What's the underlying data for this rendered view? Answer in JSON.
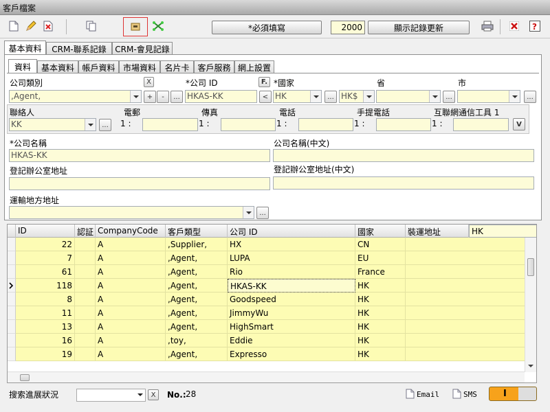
{
  "window": {
    "title": "客戶檔案"
  },
  "toolbar": {
    "required_label": "*必須填寫",
    "record_count": "2000",
    "refresh_label": "顯示記錄更新"
  },
  "main_tabs": [
    {
      "label": "基本資料",
      "active": true
    },
    {
      "label": "CRM-聯系記錄",
      "active": false
    },
    {
      "label": "CRM-會見記錄",
      "active": false
    }
  ],
  "sub_tabs": [
    {
      "label": "資料",
      "active": true
    },
    {
      "label": "基本資料",
      "active": false
    },
    {
      "label": "帳戶資料",
      "active": false
    },
    {
      "label": "市場資料",
      "active": false
    },
    {
      "label": "名片卡",
      "active": false
    },
    {
      "label": "客戶服務",
      "active": false
    },
    {
      "label": "網上設置",
      "active": false
    }
  ],
  "form": {
    "company_type_label": "公司類別",
    "company_type_value": ",Agent,",
    "company_id_label": "*公司 ID",
    "company_id_value": "HKAS-KK",
    "f_button": "F.",
    "country_label": "*國家",
    "country_value": "HK",
    "currency_value": "HK$",
    "province_label": "省",
    "city_label": "市",
    "contact_label": "聯絡人",
    "contact_value": "KK",
    "email_label": "電郵",
    "fax_label": "傳真",
    "phone_label": "電話",
    "mobile_label": "手提電話",
    "im_label": "互聯網通信工具 1",
    "index_prefix": "1 :",
    "company_name_label": "*公司名稱",
    "company_name_value": "HKAS-KK",
    "company_name_cn_label": "公司名稱(中文)",
    "office_addr_label": "登記辦公室地址",
    "office_addr_cn_label": "登記辦公室地址(中文)",
    "shipping_addr_label": "運輸地方地址",
    "x_btn": "X",
    "plus_btn": "+",
    "minus_btn": "-",
    "ellipsis": "...",
    "lt_btn": "<",
    "v_btn": "V"
  },
  "grid": {
    "headers": [
      "ID",
      "認証",
      "CompanyCode",
      "客戶類型",
      "公司 ID",
      "國家",
      "裝運地址"
    ],
    "filter_value": "HK",
    "rows": [
      {
        "id": "22",
        "cert": "",
        "code": "A",
        "type": ",Supplier,",
        "company": "HX",
        "country": "CN",
        "ship": ""
      },
      {
        "id": "7",
        "cert": "",
        "code": "A",
        "type": ",Agent,",
        "company": "LUPA",
        "country": "EU",
        "ship": ""
      },
      {
        "id": "61",
        "cert": "",
        "code": "A",
        "type": ",Agent,",
        "company": "Rio",
        "country": "France",
        "ship": ""
      },
      {
        "id": "118",
        "cert": "",
        "code": "A",
        "type": ",Agent,",
        "company": "HKAS-KK",
        "country": "HK",
        "ship": "",
        "current": true
      },
      {
        "id": "8",
        "cert": "",
        "code": "A",
        "type": ",Agent,",
        "company": "Goodspeed",
        "country": "HK",
        "ship": ""
      },
      {
        "id": "11",
        "cert": "",
        "code": "A",
        "type": ",Agent,",
        "company": "JimmyWu",
        "country": "HK",
        "ship": ""
      },
      {
        "id": "13",
        "cert": "",
        "code": "A",
        "type": ",Agent,",
        "company": "HighSmart",
        "country": "HK",
        "ship": ""
      },
      {
        "id": "16",
        "cert": "",
        "code": "A",
        "type": ",toy,",
        "company": "Eddie",
        "country": "HK",
        "ship": ""
      },
      {
        "id": "19",
        "cert": "",
        "code": "A",
        "type": ",Agent,",
        "company": "Expresso",
        "country": "HK",
        "ship": ""
      }
    ]
  },
  "status": {
    "search_label": "搜索進展狀況",
    "x_btn": "X",
    "no_label": "No.:",
    "no_value": "28",
    "email_label": "Email",
    "sms_label": "SMS",
    "toggle_text": "I"
  },
  "colors": {
    "field_bg": "#fdfcd8",
    "row_bg": "#fdfcb4",
    "accent_orange": "#f7a21b"
  }
}
